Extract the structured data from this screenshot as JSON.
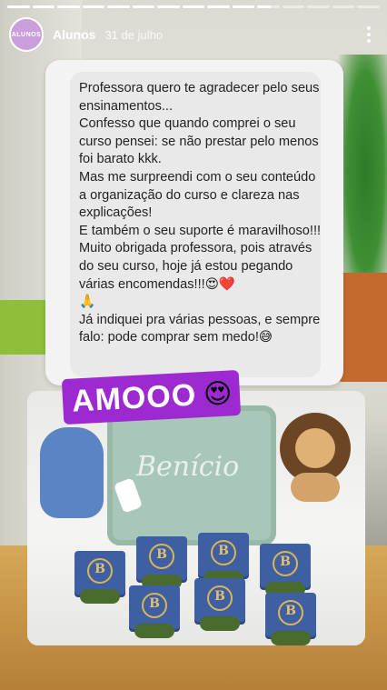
{
  "story": {
    "progress_segments": [
      {
        "fill": 1.0
      },
      {
        "fill": 1.0
      },
      {
        "fill": 1.0
      },
      {
        "fill": 1.0
      },
      {
        "fill": 1.0
      },
      {
        "fill": 1.0
      },
      {
        "fill": 1.0
      },
      {
        "fill": 1.0
      },
      {
        "fill": 1.0
      },
      {
        "fill": 1.0
      },
      {
        "fill": 0.6
      },
      {
        "fill": 0.0
      },
      {
        "fill": 0.0
      },
      {
        "fill": 0.0
      },
      {
        "fill": 0.0
      }
    ],
    "avatar_text": "ALUNOS",
    "username": "Alunos",
    "date": "31 de julho"
  },
  "message": {
    "text": "Professora quero te agradecer pelo seus ensinamentos...\nConfesso que quando comprei o seu curso pensei: se não prestar pelo menos foi barato kkk.\nMas me surpreendi com o seu conteúdo a organização do curso e clareza nas explicações!\nE também o seu suporte é maravilhoso!!!\nMuito obrigada professora, pois através do seu curso, hoje já estou pegando várias encomendas!!!😍❤️\n🙏\nJá indiquei pra várias pessoas, e sempre falo: pode comprar sem medo!😅"
  },
  "sticker": {
    "text": "AMOOO",
    "emoji": "😍"
  },
  "photo": {
    "pillow_text": "Benício",
    "box_letter": "B",
    "colors": {
      "boxes": "#3f5fa3",
      "gold": "#d8b657",
      "ribbon": "#4a6b2e",
      "pillow": "#a9c7b8"
    }
  },
  "icons": [
    "more-vertical-icon"
  ]
}
